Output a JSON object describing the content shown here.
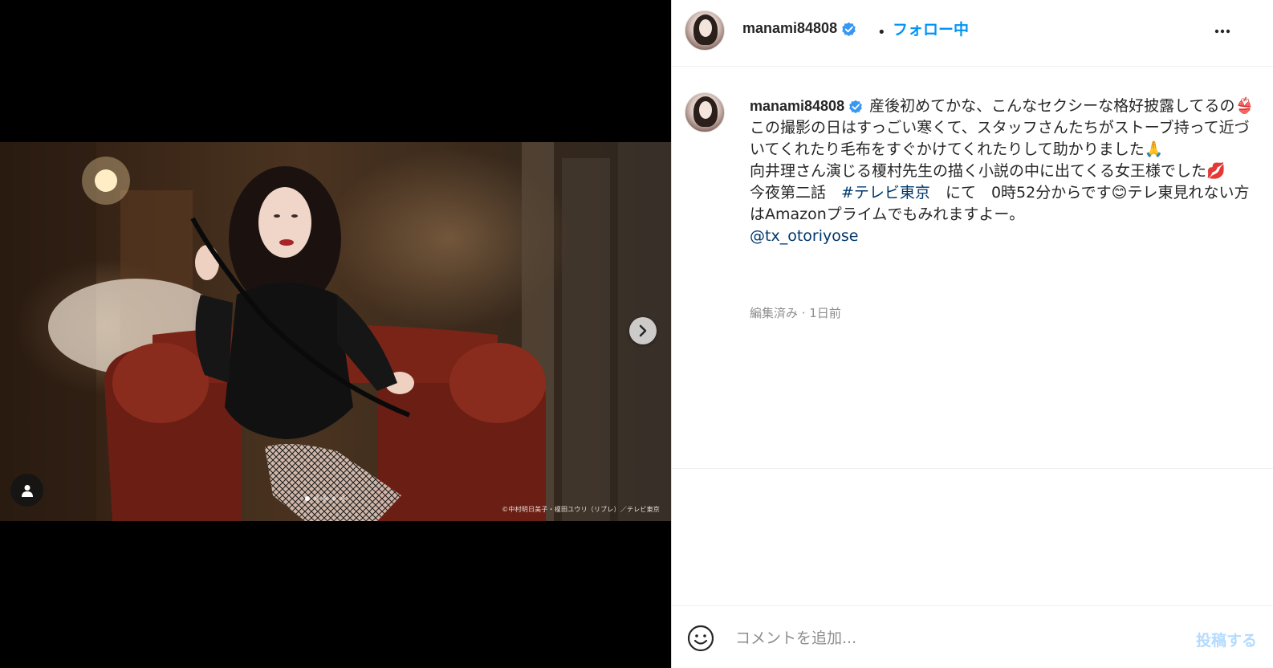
{
  "media": {
    "credit": "©中村明日美子・榎田ユウリ（リブレ）／テレビ東京",
    "slide_count": 5,
    "active_slide": 1,
    "next_icon": "chevron-right-icon",
    "tag_icon": "user-tag-icon"
  },
  "header": {
    "username": "manami84808",
    "separator": "•",
    "follow_label": "フォロー中",
    "more_icon": "more-horizontal-icon"
  },
  "caption": {
    "username": "manami84808",
    "line1": "産後初めてかな、こんなセクシーな格好披露してるの👙この撮影の日はすっごい寒くて、スタッフさんたちがストーブ持って近づいてくれたり毛布をすぐかけてくれたりして助かりました🙏",
    "line2": "向井理さん演じる榎村先生の描く小説の中に出てくる女王様でした💋",
    "line3_pre": "今夜第二話　",
    "hashtag": "#テレビ東京",
    "line3_post": "　にて　0時52分からです😊テレ東見れない方はAmazonプライムでもみれますよー。",
    "mention": "@tx_otoriyose",
    "meta": "編集済み · 1日前"
  },
  "comment": {
    "placeholder": "コメントを追加...",
    "post_label": "投稿する",
    "emoji_icon": "emoji-icon"
  },
  "colors": {
    "accent": "#0095f6",
    "verified": "#3897f0",
    "post_disabled": "#b3dbff",
    "link": "#00376b"
  }
}
